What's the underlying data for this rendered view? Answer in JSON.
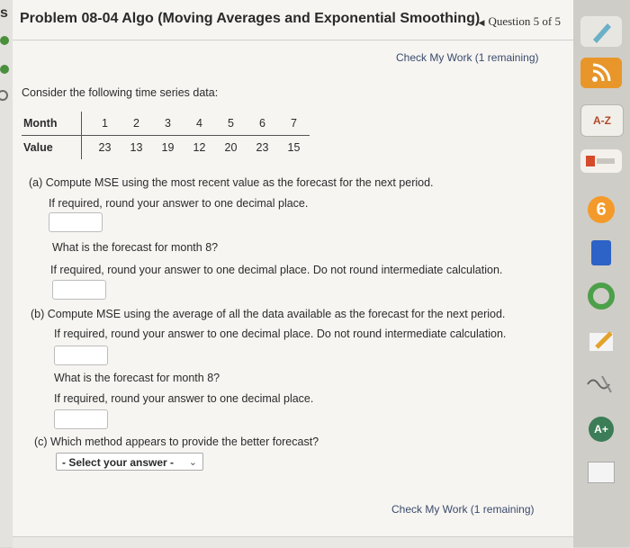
{
  "header": {
    "sidebar_letter": "s",
    "title": "Problem 08-04 Algo (Moving Averages and Exponential Smoothing)",
    "question_nav": "Question 5 of 5"
  },
  "check_top": "Check My Work (1 remaining)",
  "check_bottom": "Check My Work (1 remaining)",
  "intro": "Consider the following time series data:",
  "table": {
    "month_label": "Month",
    "value_label": "Value",
    "months": [
      "1",
      "2",
      "3",
      "4",
      "5",
      "6",
      "7"
    ],
    "values": [
      "23",
      "13",
      "19",
      "12",
      "20",
      "23",
      "15"
    ]
  },
  "part_a": {
    "question": "(a) Compute MSE using the most recent value as the forecast for the next period.",
    "round_note": "If required, round your answer to one decimal place.",
    "forecast_question": "What is the forecast for month 8?",
    "forecast_note": "If required, round your answer to one decimal place. Do not round intermediate calculation."
  },
  "part_b": {
    "question": "(b) Compute MSE using the average of all the data available as the forecast for the next period.",
    "round_note": "If required, round your answer to one decimal place. Do not round intermediate calculation.",
    "forecast_question": "What is the forecast for month 8?",
    "forecast_note": "If required, round your answer to one decimal place."
  },
  "part_c": {
    "question": "(c) Which method appears to provide the better forecast?",
    "select_value": "- Select your answer -"
  },
  "dock": {
    "icon_a2": "A-Z",
    "icon_6": "6",
    "icon_aplus": "A+"
  }
}
